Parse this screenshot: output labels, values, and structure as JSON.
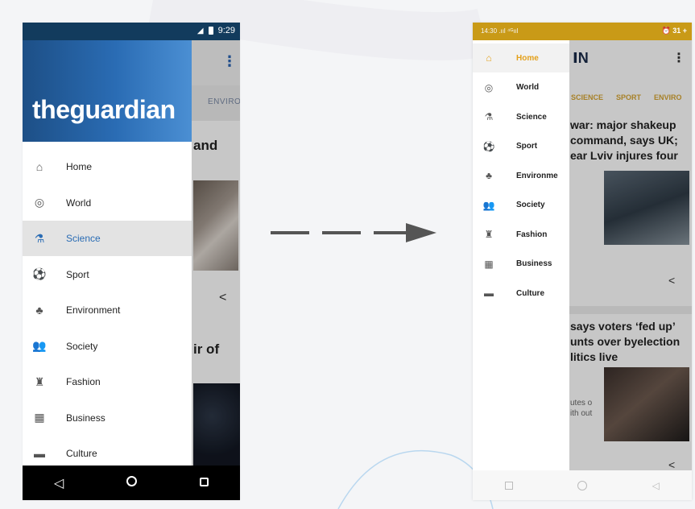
{
  "left_phone": {
    "status_time": "9:29",
    "brand": "theguardian",
    "tab_peek": "ENVIRON",
    "headline_peek_1": "and",
    "headline_peek_2": "ir of",
    "nav_items": [
      {
        "label": "Home",
        "icon": "home-icon"
      },
      {
        "label": "World",
        "icon": "globe-icon"
      },
      {
        "label": "Science",
        "icon": "flask-icon"
      },
      {
        "label": "Sport",
        "icon": "soccer-ball-icon"
      },
      {
        "label": "Environment",
        "icon": "tree-icon"
      },
      {
        "label": "Society",
        "icon": "people-icon"
      },
      {
        "label": "Fashion",
        "icon": "dress-icon"
      },
      {
        "label": "Business",
        "icon": "building-icon"
      },
      {
        "label": "Culture",
        "icon": "clapperboard-icon"
      }
    ],
    "active_item": "Science",
    "accent": "#2a6cb4"
  },
  "right_phone": {
    "status_left": "14:30 .ııl ⁴ᴳııl",
    "status_right": "⏰ 31 +",
    "logo_peek": "ⅠN",
    "tabs": [
      "SCIENCE",
      "SPORT",
      "ENVIRO"
    ],
    "headline_1": "war: major shakeup command, says UK; ear Lviv injures four",
    "headline_2": "says voters ‘fed up’ unts over byelection litics live",
    "subtext": "utes o ith out",
    "nav_items": [
      {
        "label": "Home",
        "icon": "home-icon"
      },
      {
        "label": "World",
        "icon": "globe-icon"
      },
      {
        "label": "Science",
        "icon": "flask-icon"
      },
      {
        "label": "Sport",
        "icon": "soccer-ball-icon"
      },
      {
        "label": "Environme",
        "icon": "tree-icon"
      },
      {
        "label": "Society",
        "icon": "people-icon"
      },
      {
        "label": "Fashion",
        "icon": "dress-icon"
      },
      {
        "label": "Business",
        "icon": "building-icon"
      },
      {
        "label": "Culture",
        "icon": "clapperboard-icon"
      }
    ],
    "active_item": "Home",
    "accent": "#e4a11b"
  }
}
